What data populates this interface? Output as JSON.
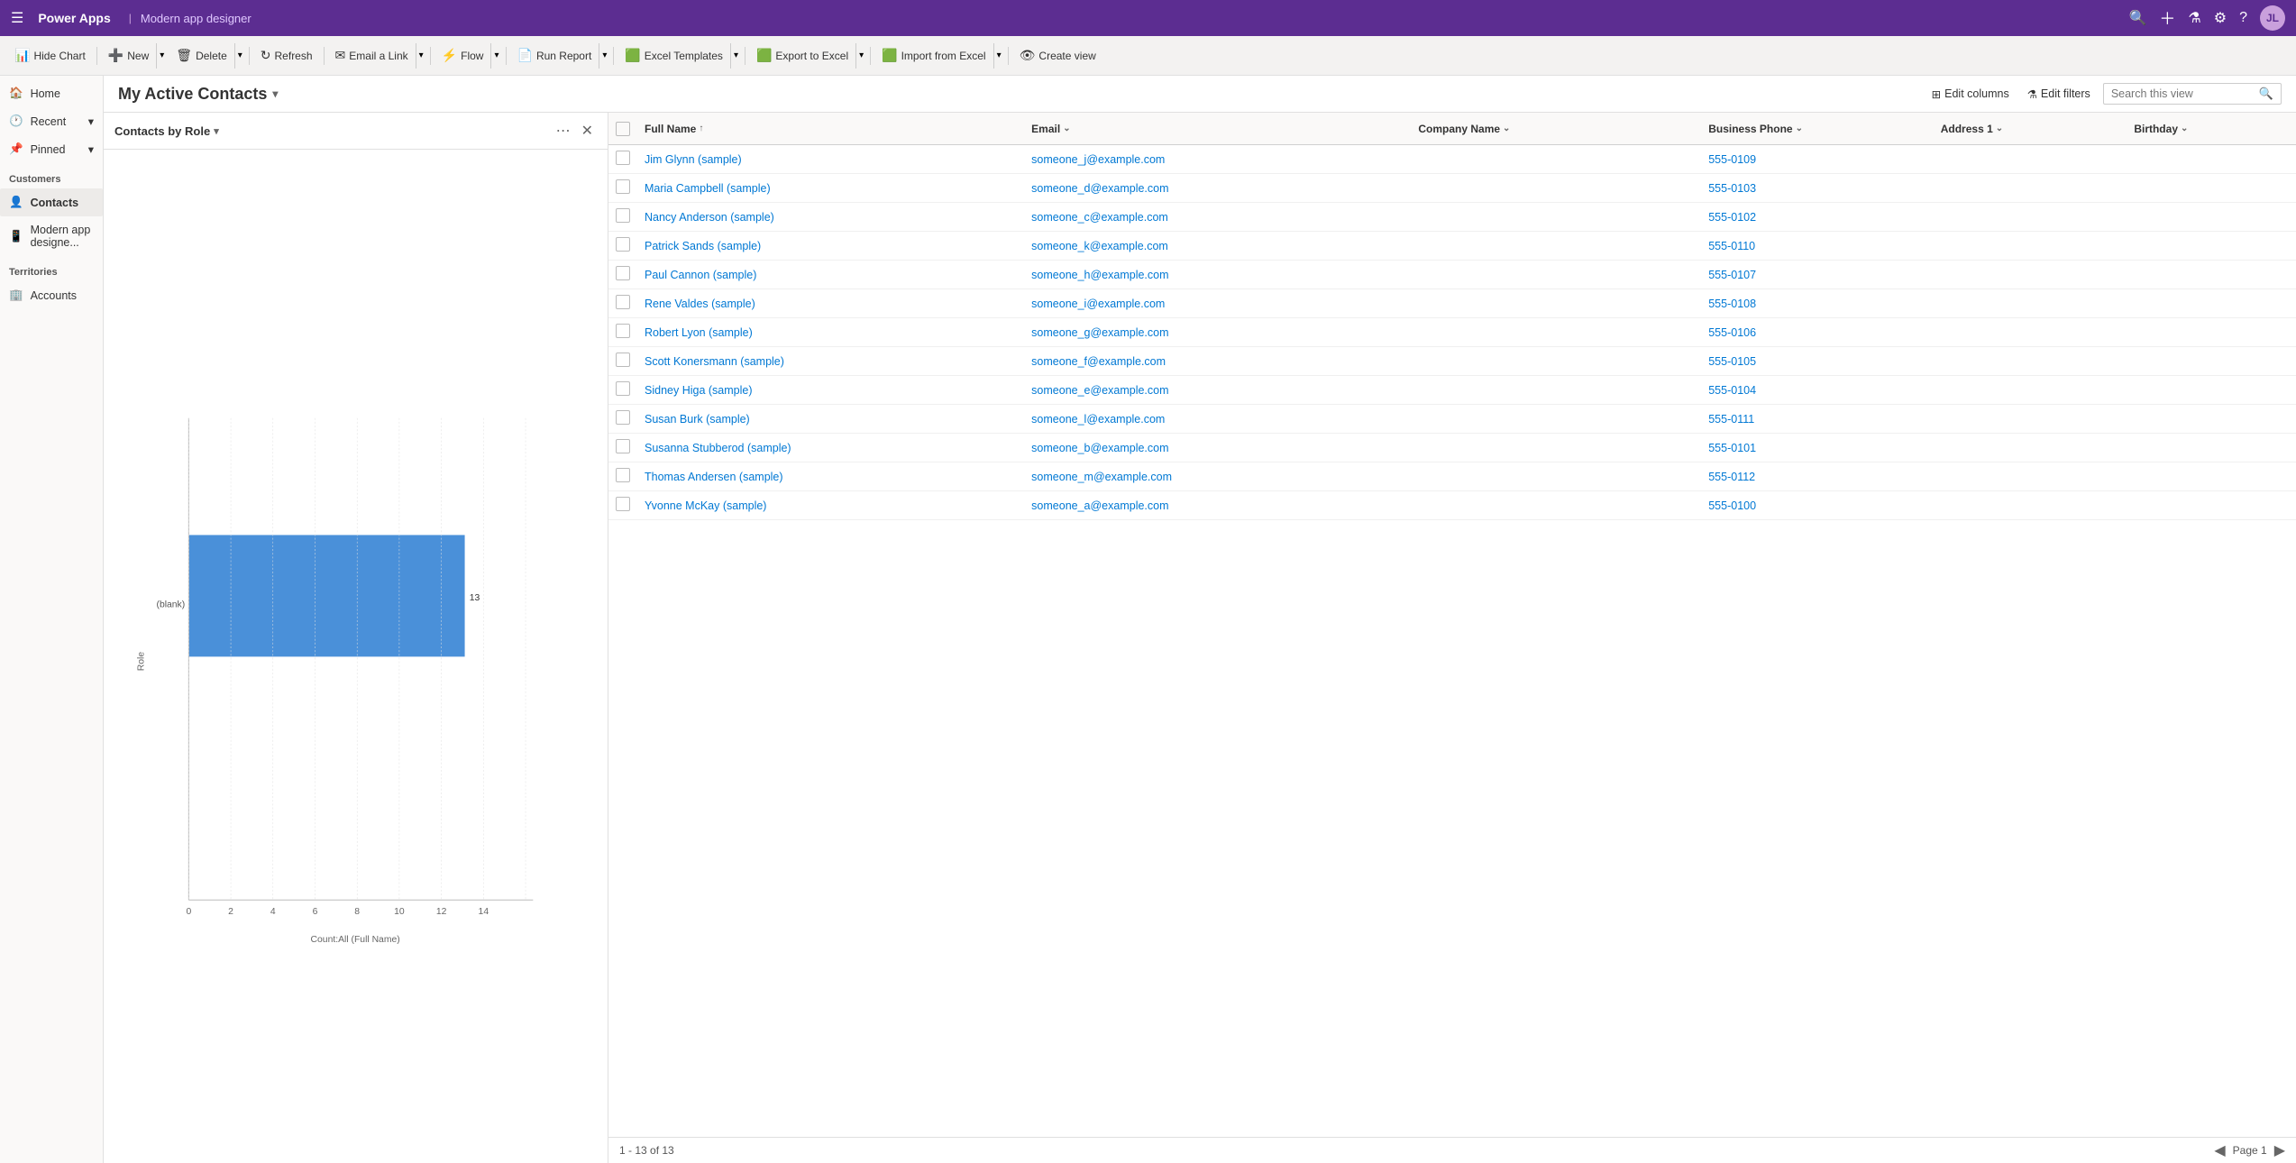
{
  "topbar": {
    "brand": "Power Apps",
    "app_title": "Modern app designer",
    "avatar_initials": "JL"
  },
  "toolbar": {
    "hide_chart": "Hide Chart",
    "new": "New",
    "delete": "Delete",
    "refresh": "Refresh",
    "email_a_link": "Email a Link",
    "flow": "Flow",
    "run_report": "Run Report",
    "excel_templates": "Excel Templates",
    "export_to_excel": "Export to Excel",
    "import_from_excel": "Import from Excel",
    "create_view": "Create view"
  },
  "sidebar": {
    "home": "Home",
    "recent": "Recent",
    "pinned": "Pinned",
    "customers_section": "Customers",
    "contacts": "Contacts",
    "modern_app_designer": "Modern app designe...",
    "territories_section": "Territories",
    "accounts": "Accounts"
  },
  "view": {
    "title": "My Active Contacts",
    "edit_columns": "Edit columns",
    "edit_filters": "Edit filters",
    "search_placeholder": "Search this view"
  },
  "chart": {
    "title": "Contacts by Role",
    "bar_label": "(blank)",
    "bar_value": 13,
    "x_axis_label": "Count:All (Full Name)",
    "y_axis_label": "Role",
    "x_ticks": [
      0,
      2,
      4,
      6,
      8,
      10,
      12,
      14
    ]
  },
  "grid": {
    "columns": [
      {
        "key": "fullname",
        "label": "Full Name",
        "sortable": true,
        "sort_asc": true
      },
      {
        "key": "email",
        "label": "Email",
        "sortable": true
      },
      {
        "key": "company",
        "label": "Company Name",
        "sortable": true
      },
      {
        "key": "phone",
        "label": "Business Phone",
        "sortable": true
      },
      {
        "key": "address",
        "label": "Address 1",
        "sortable": true
      },
      {
        "key": "birthday",
        "label": "Birthday",
        "sortable": true
      }
    ],
    "rows": [
      {
        "fullname": "Jim Glynn (sample)",
        "email": "someone_j@example.com",
        "company": "",
        "phone": "555-0109",
        "address": "",
        "birthday": ""
      },
      {
        "fullname": "Maria Campbell (sample)",
        "email": "someone_d@example.com",
        "company": "",
        "phone": "555-0103",
        "address": "",
        "birthday": ""
      },
      {
        "fullname": "Nancy Anderson (sample)",
        "email": "someone_c@example.com",
        "company": "",
        "phone": "555-0102",
        "address": "",
        "birthday": ""
      },
      {
        "fullname": "Patrick Sands (sample)",
        "email": "someone_k@example.com",
        "company": "",
        "phone": "555-0110",
        "address": "",
        "birthday": ""
      },
      {
        "fullname": "Paul Cannon (sample)",
        "email": "someone_h@example.com",
        "company": "",
        "phone": "555-0107",
        "address": "",
        "birthday": ""
      },
      {
        "fullname": "Rene Valdes (sample)",
        "email": "someone_i@example.com",
        "company": "",
        "phone": "555-0108",
        "address": "",
        "birthday": ""
      },
      {
        "fullname": "Robert Lyon (sample)",
        "email": "someone_g@example.com",
        "company": "",
        "phone": "555-0106",
        "address": "",
        "birthday": ""
      },
      {
        "fullname": "Scott Konersmann (sample)",
        "email": "someone_f@example.com",
        "company": "",
        "phone": "555-0105",
        "address": "",
        "birthday": ""
      },
      {
        "fullname": "Sidney Higa (sample)",
        "email": "someone_e@example.com",
        "company": "",
        "phone": "555-0104",
        "address": "",
        "birthday": ""
      },
      {
        "fullname": "Susan Burk (sample)",
        "email": "someone_l@example.com",
        "company": "",
        "phone": "555-0111",
        "address": "",
        "birthday": ""
      },
      {
        "fullname": "Susanna Stubberod (sample)",
        "email": "someone_b@example.com",
        "company": "",
        "phone": "555-0101",
        "address": "",
        "birthday": ""
      },
      {
        "fullname": "Thomas Andersen (sample)",
        "email": "someone_m@example.com",
        "company": "",
        "phone": "555-0112",
        "address": "",
        "birthday": ""
      },
      {
        "fullname": "Yvonne McKay (sample)",
        "email": "someone_a@example.com",
        "company": "",
        "phone": "555-0100",
        "address": "",
        "birthday": ""
      }
    ],
    "footer": {
      "record_count": "1 - 13 of 13",
      "page": "Page 1"
    }
  }
}
